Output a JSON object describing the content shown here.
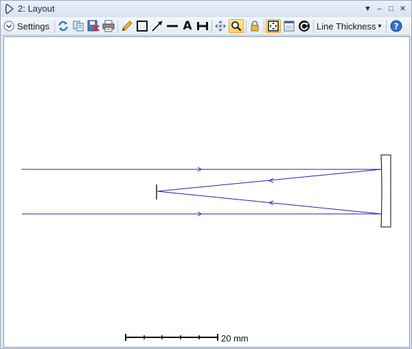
{
  "window": {
    "title": "2: Layout",
    "controls": {
      "menu": "▼",
      "minimize": "–",
      "maximize": "□",
      "close": "✕"
    }
  },
  "toolbar": {
    "settings_label": "Settings",
    "line_thickness_label": "Line Thickness",
    "line_thickness_arrow": "▾",
    "text_tool_glyph": "A",
    "help_glyph": "?",
    "icons": [
      "refresh-icon",
      "copy-icon",
      "save-icon",
      "print-icon",
      "pencil-icon",
      "rectangle-icon",
      "arrow-line-icon",
      "line-icon",
      "text-icon",
      "dimension-icon",
      "pan-icon",
      "zoom-icon",
      "lock-icon",
      "fit-view-icon",
      "window-icon",
      "rotate-icon",
      "help-icon"
    ],
    "active_tools": [
      "zoom",
      "fit-view"
    ]
  },
  "layout": {
    "scale_bar": {
      "label": "20 mm",
      "divisions": 5
    }
  },
  "colors": {
    "ray": "#1f1fb4",
    "surface": "#000000",
    "active_bg": "#ffd25a"
  }
}
